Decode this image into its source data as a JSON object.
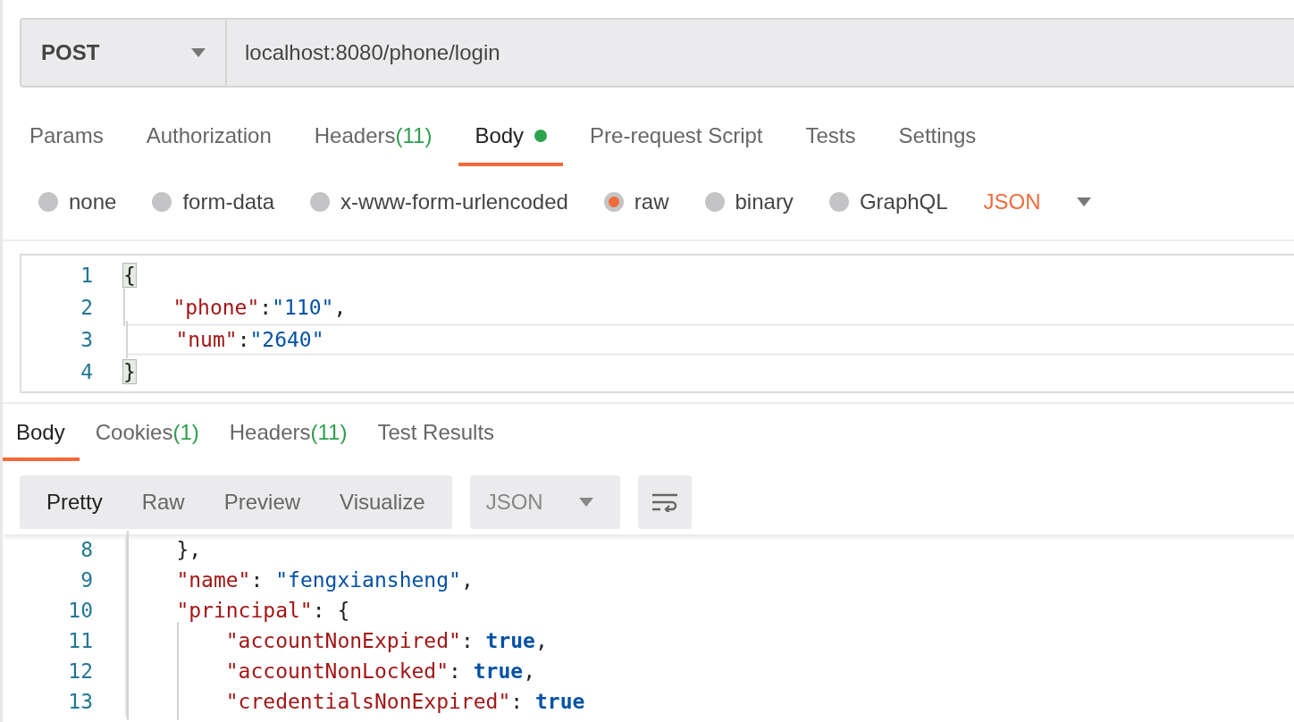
{
  "request": {
    "method": "POST",
    "url": "localhost:8080/phone/login"
  },
  "request_tabs": [
    {
      "label": "Params",
      "selected": false
    },
    {
      "label": "Authorization",
      "selected": false
    },
    {
      "label": "Headers",
      "count": "(11)",
      "selected": false
    },
    {
      "label": "Body",
      "has_content": true,
      "selected": true
    },
    {
      "label": "Pre-request Script",
      "selected": false
    },
    {
      "label": "Tests",
      "selected": false
    },
    {
      "label": "Settings",
      "selected": false
    }
  ],
  "body_types": [
    {
      "label": "none",
      "selected": false
    },
    {
      "label": "form-data",
      "selected": false
    },
    {
      "label": "x-www-form-urlencoded",
      "selected": false
    },
    {
      "label": "raw",
      "selected": true
    },
    {
      "label": "binary",
      "selected": false
    },
    {
      "label": "GraphQL",
      "selected": false
    }
  ],
  "body_format": "JSON",
  "request_body": [
    {
      "number": "1",
      "current": false,
      "tokens": [
        {
          "kind": "match",
          "text": "{"
        }
      ]
    },
    {
      "number": "2",
      "current": false,
      "tokens": [
        {
          "kind": "key",
          "text": "    \"phone\""
        },
        {
          "kind": "punct",
          "text": ":"
        },
        {
          "kind": "string",
          "text": "\"110\""
        },
        {
          "kind": "punct",
          "text": ","
        }
      ]
    },
    {
      "number": "3",
      "current": true,
      "tokens": [
        {
          "kind": "key",
          "text": "    \"num\""
        },
        {
          "kind": "punct",
          "text": ":"
        },
        {
          "kind": "string",
          "text": "\"2640\""
        }
      ]
    },
    {
      "number": "4",
      "current": false,
      "tokens": [
        {
          "kind": "match",
          "text": "}"
        }
      ]
    }
  ],
  "response_tabs": [
    {
      "label": "Body",
      "selected": true
    },
    {
      "label": "Cookies",
      "count": "(1)",
      "selected": false
    },
    {
      "label": "Headers",
      "count": "(11)",
      "selected": false
    },
    {
      "label": "Test Results",
      "selected": false
    }
  ],
  "view_modes": [
    {
      "label": "Pretty",
      "selected": true
    },
    {
      "label": "Raw",
      "selected": false
    },
    {
      "label": "Preview",
      "selected": false
    },
    {
      "label": "Visualize",
      "selected": false
    }
  ],
  "response_format": "JSON",
  "response_body": [
    {
      "number": "8",
      "tokens": [
        {
          "kind": "punct",
          "text": "    },"
        }
      ]
    },
    {
      "number": "9",
      "tokens": [
        {
          "kind": "key",
          "text": "    \"name\""
        },
        {
          "kind": "punct",
          "text": ": "
        },
        {
          "kind": "string",
          "text": "\"fengxiansheng\""
        },
        {
          "kind": "punct",
          "text": ","
        }
      ]
    },
    {
      "number": "10",
      "tokens": [
        {
          "kind": "key",
          "text": "    \"principal\""
        },
        {
          "kind": "punct",
          "text": ": {"
        }
      ]
    },
    {
      "number": "11",
      "tokens": [
        {
          "kind": "key",
          "text": "        \"accountNonExpired\""
        },
        {
          "kind": "punct",
          "text": ": "
        },
        {
          "kind": "bool",
          "text": "true"
        },
        {
          "kind": "punct",
          "text": ","
        }
      ]
    },
    {
      "number": "12",
      "tokens": [
        {
          "kind": "key",
          "text": "        \"accountNonLocked\""
        },
        {
          "kind": "punct",
          "text": ": "
        },
        {
          "kind": "bool",
          "text": "true"
        },
        {
          "kind": "punct",
          "text": ","
        }
      ]
    },
    {
      "number": "13",
      "tokens": [
        {
          "kind": "key",
          "text": "        \"credentialsNonExpired\""
        },
        {
          "kind": "punct",
          "text": ": "
        },
        {
          "kind": "bool",
          "text": "true"
        }
      ]
    }
  ]
}
